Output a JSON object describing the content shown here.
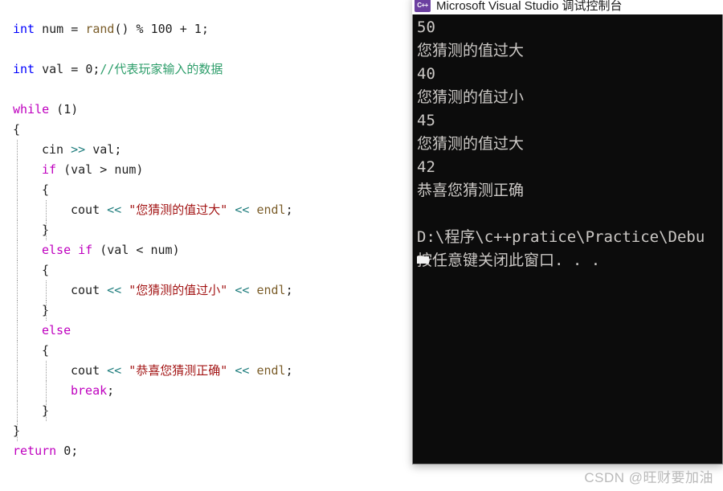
{
  "editor": {
    "language": "cpp",
    "lines": [
      {
        "indent": 0,
        "guides": [],
        "tokens": [
          {
            "t": "int",
            "c": "kw"
          },
          {
            "t": " ",
            "c": "plain"
          },
          {
            "t": "num",
            "c": "var"
          },
          {
            "t": " = ",
            "c": "plain"
          },
          {
            "t": "rand",
            "c": "fn"
          },
          {
            "t": "() ",
            "c": "plain"
          },
          {
            "t": "%",
            "c": "plain"
          },
          {
            "t": " ",
            "c": "plain"
          },
          {
            "t": "100",
            "c": "num"
          },
          {
            "t": " + ",
            "c": "plain"
          },
          {
            "t": "1",
            "c": "num"
          },
          {
            "t": ";",
            "c": "plain"
          }
        ]
      },
      {
        "indent": 0,
        "guides": [],
        "tokens": []
      },
      {
        "indent": 0,
        "guides": [],
        "tokens": [
          {
            "t": "int",
            "c": "kw"
          },
          {
            "t": " ",
            "c": "plain"
          },
          {
            "t": "val",
            "c": "var"
          },
          {
            "t": " = ",
            "c": "plain"
          },
          {
            "t": "0",
            "c": "num"
          },
          {
            "t": ";",
            "c": "plain"
          },
          {
            "t": "//代表玩家输入的数据",
            "c": "cmt"
          }
        ]
      },
      {
        "indent": 0,
        "guides": [],
        "tokens": []
      },
      {
        "indent": 0,
        "guides": [],
        "tokens": [
          {
            "t": "while",
            "c": "kwctl"
          },
          {
            "t": " (",
            "c": "plain"
          },
          {
            "t": "1",
            "c": "num"
          },
          {
            "t": ")",
            "c": "plain"
          }
        ]
      },
      {
        "indent": 0,
        "guides": [],
        "tokens": [
          {
            "t": "{",
            "c": "plain"
          }
        ]
      },
      {
        "indent": 1,
        "guides": [
          "g1"
        ],
        "tokens": [
          {
            "t": "cin",
            "c": "var"
          },
          {
            "t": " ",
            "c": "plain"
          },
          {
            "t": ">>",
            "c": "op"
          },
          {
            "t": " ",
            "c": "plain"
          },
          {
            "t": "val",
            "c": "var"
          },
          {
            "t": ";",
            "c": "plain"
          }
        ]
      },
      {
        "indent": 1,
        "guides": [
          "g1"
        ],
        "tokens": [
          {
            "t": "if",
            "c": "kwctl"
          },
          {
            "t": " (",
            "c": "plain"
          },
          {
            "t": "val",
            "c": "var"
          },
          {
            "t": " ",
            "c": "plain"
          },
          {
            "t": ">",
            "c": "plain"
          },
          {
            "t": " ",
            "c": "plain"
          },
          {
            "t": "num",
            "c": "var"
          },
          {
            "t": ")",
            "c": "plain"
          }
        ]
      },
      {
        "indent": 1,
        "guides": [
          "g1"
        ],
        "tokens": [
          {
            "t": "{",
            "c": "plain"
          }
        ]
      },
      {
        "indent": 2,
        "guides": [
          "g1",
          "g2"
        ],
        "tokens": [
          {
            "t": "cout",
            "c": "var"
          },
          {
            "t": " ",
            "c": "plain"
          },
          {
            "t": "<<",
            "c": "op"
          },
          {
            "t": " ",
            "c": "plain"
          },
          {
            "t": "\"您猜测的值过大\"",
            "c": "str"
          },
          {
            "t": " ",
            "c": "plain"
          },
          {
            "t": "<<",
            "c": "op"
          },
          {
            "t": " ",
            "c": "plain"
          },
          {
            "t": "endl",
            "c": "fn"
          },
          {
            "t": ";",
            "c": "plain"
          }
        ]
      },
      {
        "indent": 1,
        "guides": [
          "g1",
          "g2"
        ],
        "tokens": [
          {
            "t": "}",
            "c": "plain"
          }
        ]
      },
      {
        "indent": 1,
        "guides": [
          "g1"
        ],
        "tokens": [
          {
            "t": "else",
            "c": "kwctl"
          },
          {
            "t": " ",
            "c": "plain"
          },
          {
            "t": "if",
            "c": "kwctl"
          },
          {
            "t": " (",
            "c": "plain"
          },
          {
            "t": "val",
            "c": "var"
          },
          {
            "t": " ",
            "c": "plain"
          },
          {
            "t": "<",
            "c": "plain"
          },
          {
            "t": " ",
            "c": "plain"
          },
          {
            "t": "num",
            "c": "var"
          },
          {
            "t": ")",
            "c": "plain"
          }
        ]
      },
      {
        "indent": 1,
        "guides": [
          "g1"
        ],
        "tokens": [
          {
            "t": "{",
            "c": "plain"
          }
        ]
      },
      {
        "indent": 2,
        "guides": [
          "g1",
          "g2"
        ],
        "tokens": [
          {
            "t": "cout",
            "c": "var"
          },
          {
            "t": " ",
            "c": "plain"
          },
          {
            "t": "<<",
            "c": "op"
          },
          {
            "t": " ",
            "c": "plain"
          },
          {
            "t": "\"您猜测的值过小\"",
            "c": "str"
          },
          {
            "t": " ",
            "c": "plain"
          },
          {
            "t": "<<",
            "c": "op"
          },
          {
            "t": " ",
            "c": "plain"
          },
          {
            "t": "endl",
            "c": "fn"
          },
          {
            "t": ";",
            "c": "plain"
          }
        ]
      },
      {
        "indent": 1,
        "guides": [
          "g1",
          "g2"
        ],
        "tokens": [
          {
            "t": "}",
            "c": "plain"
          }
        ]
      },
      {
        "indent": 1,
        "guides": [
          "g1"
        ],
        "tokens": [
          {
            "t": "else",
            "c": "kwctl"
          }
        ]
      },
      {
        "indent": 1,
        "guides": [
          "g1"
        ],
        "tokens": [
          {
            "t": "{",
            "c": "plain"
          }
        ]
      },
      {
        "indent": 2,
        "guides": [
          "g1",
          "g2"
        ],
        "tokens": [
          {
            "t": "cout",
            "c": "var"
          },
          {
            "t": " ",
            "c": "plain"
          },
          {
            "t": "<<",
            "c": "op"
          },
          {
            "t": " ",
            "c": "plain"
          },
          {
            "t": "\"恭喜您猜测正确\"",
            "c": "str"
          },
          {
            "t": " ",
            "c": "plain"
          },
          {
            "t": "<<",
            "c": "op"
          },
          {
            "t": " ",
            "c": "plain"
          },
          {
            "t": "endl",
            "c": "fn"
          },
          {
            "t": ";",
            "c": "plain"
          }
        ]
      },
      {
        "indent": 2,
        "guides": [
          "g1",
          "g2"
        ],
        "tokens": [
          {
            "t": "break",
            "c": "kwctl"
          },
          {
            "t": ";",
            "c": "plain"
          }
        ]
      },
      {
        "indent": 1,
        "guides": [
          "g1",
          "g2"
        ],
        "tokens": [
          {
            "t": "}",
            "c": "plain"
          }
        ]
      },
      {
        "indent": 0,
        "guides": [
          "g1"
        ],
        "tokens": [
          {
            "t": "}",
            "c": "plain"
          }
        ]
      },
      {
        "indent": 0,
        "guides": [],
        "tokens": [
          {
            "t": "return",
            "c": "kwctl"
          },
          {
            "t": " ",
            "c": "plain"
          },
          {
            "t": "0",
            "c": "num"
          },
          {
            "t": ";",
            "c": "plain"
          }
        ]
      }
    ]
  },
  "console": {
    "title": "Microsoft Visual Studio 调试控制台",
    "icon": "visual-studio-cpp-icon",
    "background_color": "#0c0c0c",
    "text_color": "#ccc9c6",
    "output_lines": [
      "50",
      "您猜测的值过大",
      "40",
      "您猜测的值过小",
      "45",
      "您猜测的值过大",
      "42",
      "恭喜您猜测正确",
      "",
      "D:\\程序\\c++pratice\\Practice\\Debu",
      "按任意键关闭此窗口. . ."
    ]
  },
  "watermark": {
    "text": "CSDN @旺财要加油"
  }
}
